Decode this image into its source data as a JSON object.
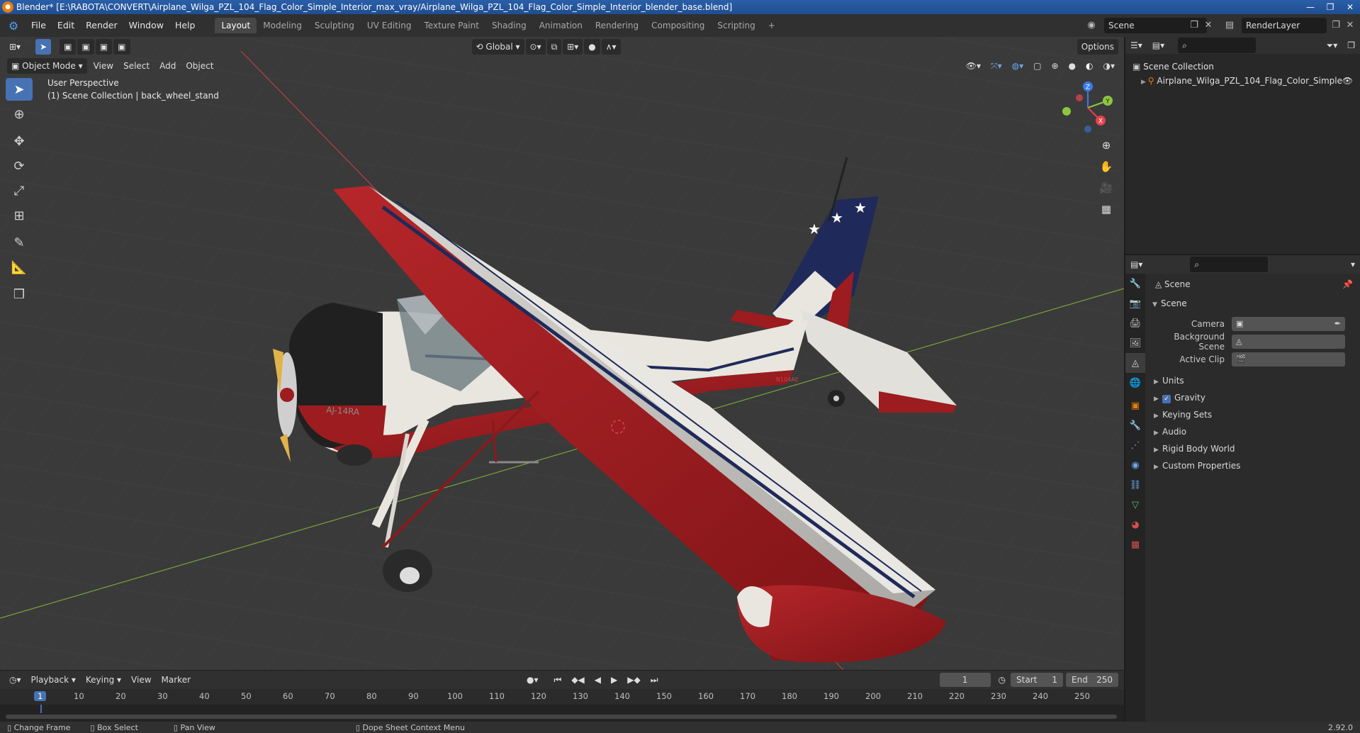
{
  "window": {
    "title": "Blender* [E:\\RABOTA\\CONVERT\\Airplane_Wilga_PZL_104_Flag_Color_Simple_Interior_max_vray/Airplane_Wilga_PZL_104_Flag_Color_Simple_Interior_blender_base.blend]",
    "controls": [
      "—",
      "❐",
      "✕"
    ]
  },
  "menu": [
    "File",
    "Edit",
    "Render",
    "Window",
    "Help"
  ],
  "workspaces": [
    "Layout",
    "Modeling",
    "Sculpting",
    "UV Editing",
    "Texture Paint",
    "Shading",
    "Animation",
    "Rendering",
    "Compositing",
    "Scripting"
  ],
  "workspace_add": "+",
  "scene_name": "Scene",
  "render_layer": "RenderLayer",
  "viewport": {
    "transform_orientation": "Global",
    "options_label": "Options",
    "mode": "Object Mode",
    "menus": [
      "View",
      "Select",
      "Add",
      "Object"
    ],
    "info_line1": "User Perspective",
    "info_line2": "(1) Scene Collection | back_wheel_stand",
    "tail_number": "AJ-14RA",
    "tail_number2": "N104AE"
  },
  "gizmo": {
    "z": "Z",
    "y": "Y",
    "x": "X"
  },
  "outliner": {
    "root": "Scene Collection",
    "item": "Airplane_Wilga_PZL_104_Flag_Color_Simple"
  },
  "properties": {
    "title": "Scene",
    "panel": "Scene",
    "fields": [
      {
        "label": "Camera"
      },
      {
        "label": "Background Scene"
      },
      {
        "label": "Active Clip"
      }
    ],
    "subpanels": [
      "Units",
      "Gravity",
      "Keying Sets",
      "Audio",
      "Rigid Body World",
      "Custom Properties"
    ]
  },
  "timeline": {
    "menus": [
      "Playback",
      "Keying",
      "View",
      "Marker"
    ],
    "current_frame": "1",
    "start_label": "Start",
    "start_value": "1",
    "end_label": "End",
    "end_value": "250",
    "ticks": [
      "1",
      "10",
      "20",
      "30",
      "40",
      "50",
      "60",
      "70",
      "80",
      "90",
      "100",
      "110",
      "120",
      "130",
      "140",
      "150",
      "160",
      "170",
      "180",
      "190",
      "200",
      "210",
      "220",
      "230",
      "240",
      "250"
    ]
  },
  "statusbar": {
    "items": [
      "Change Frame",
      "Box Select",
      "Pan View",
      "Dope Sheet Context Menu"
    ],
    "version": "2.92.0"
  },
  "colors": {
    "accent": "#4772b3",
    "orange": "#e87d0d",
    "axis_x": "#e54150",
    "axis_y": "#8cc63f",
    "axis_z": "#3b7be8",
    "plane_red": "#9c1c1f",
    "plane_white": "#e9e6df",
    "plane_navy": "#1f2a5a"
  }
}
